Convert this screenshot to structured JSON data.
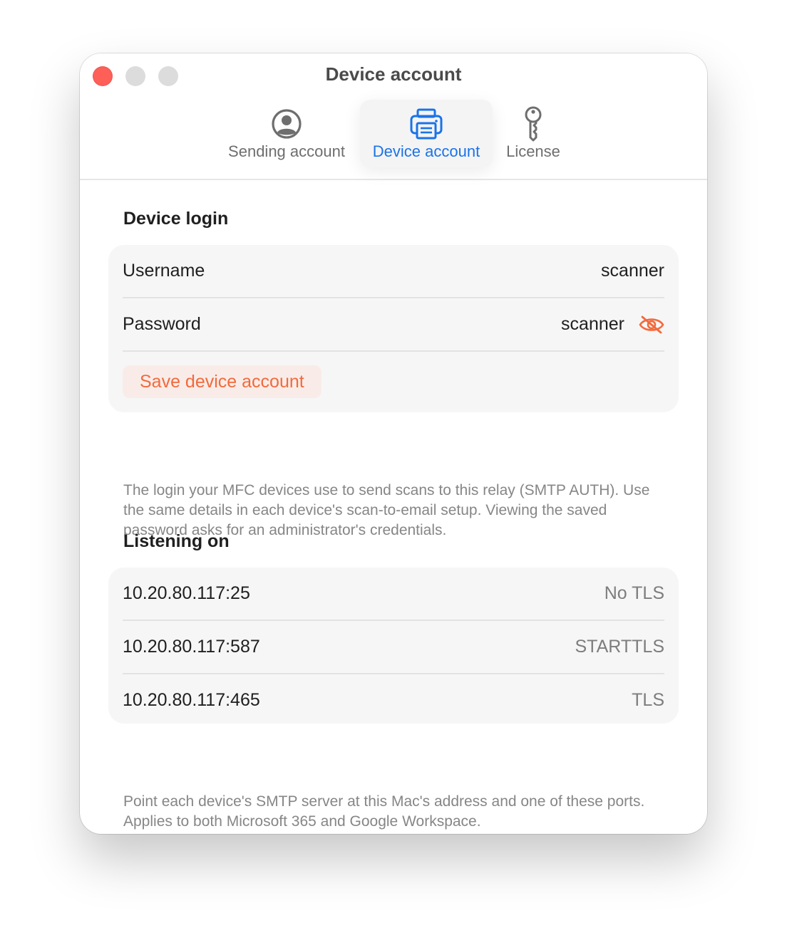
{
  "window": {
    "title": "Device account"
  },
  "tabs": [
    {
      "label": "Sending account",
      "icon": "person-circle-icon",
      "active": false
    },
    {
      "label": "Device account",
      "icon": "printer-icon",
      "active": true
    },
    {
      "label": "License",
      "icon": "key-icon",
      "active": false
    }
  ],
  "device_login": {
    "title": "Device login",
    "username_label": "Username",
    "username_value": "scanner",
    "password_label": "Password",
    "password_value": "scanner",
    "save_label": "Save device account",
    "note": "The login your MFC devices use to send scans to this relay (SMTP AUTH). Use the same details in each device's scan-to-email setup. Viewing the saved password asks for an administrator's credentials."
  },
  "listening": {
    "title": "Listening on",
    "rows": [
      {
        "address": "10.20.80.117:25",
        "security": "No TLS"
      },
      {
        "address": "10.20.80.117:587",
        "security": "STARTTLS"
      },
      {
        "address": "10.20.80.117:465",
        "security": "TLS"
      }
    ],
    "note": "Point each device's SMTP server at this Mac's address and one of these ports. Applies to both Microsoft 365 and Google Workspace."
  },
  "colors": {
    "accent_blue": "#1a73e8",
    "accent_orange": "#f26a3c",
    "close_red": "#fe5f57"
  }
}
